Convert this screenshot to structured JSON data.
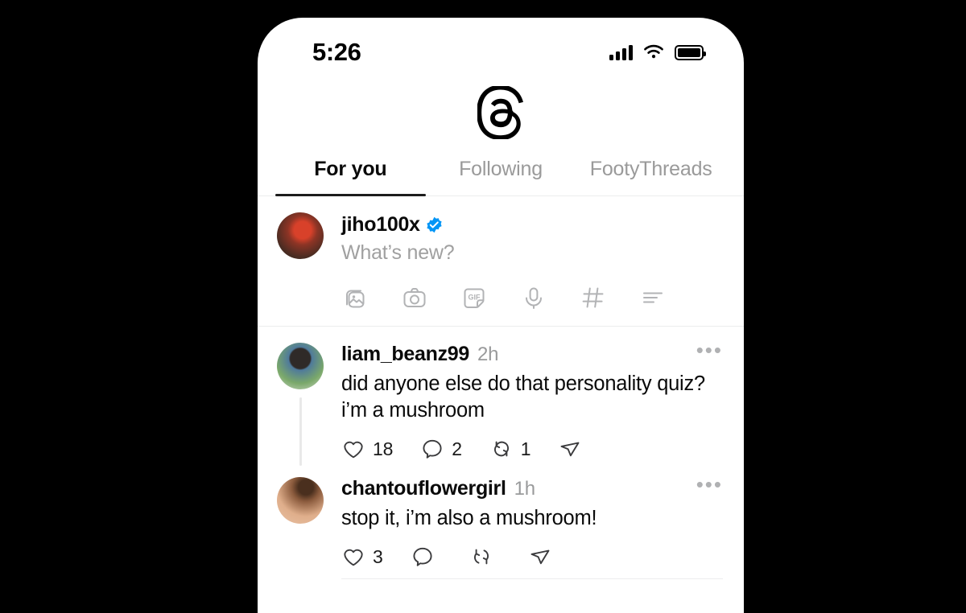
{
  "status_bar": {
    "time": "5:26",
    "cellular_icon": "signal-bars-icon",
    "wifi_icon": "wifi-icon",
    "battery_icon": "battery-full-icon"
  },
  "app": {
    "name": "Threads",
    "logo_icon": "threads-logo-icon"
  },
  "tabs": [
    {
      "label": "For you",
      "active": true
    },
    {
      "label": "Following",
      "active": false
    },
    {
      "label": "FootyThreads",
      "active": false
    }
  ],
  "composer": {
    "username": "jiho100x",
    "verified": true,
    "verified_color": "#0095F6",
    "placeholder": "What’s new?",
    "avatar_colors": [
      "#5a3a30",
      "#c0392b"
    ],
    "icons": [
      {
        "name": "photo-gallery-icon",
        "label": "Add photo"
      },
      {
        "name": "camera-icon",
        "label": "Camera"
      },
      {
        "name": "gif-sticker-icon",
        "label": "GIF"
      },
      {
        "name": "microphone-icon",
        "label": "Voice"
      },
      {
        "name": "hashtag-icon",
        "label": "Tag"
      },
      {
        "name": "poll-list-icon",
        "label": "Poll"
      }
    ]
  },
  "posts": [
    {
      "username": "liam_beanz99",
      "timestamp": "2h",
      "text": "did anyone else do that personality quiz? i’m a mushroom",
      "avatar_colors": [
        "#6b8e3d",
        "#2a5f9e"
      ],
      "more_icon": "more-options-icon",
      "actions": {
        "like": {
          "icon": "heart-icon",
          "count": "18"
        },
        "reply": {
          "icon": "comment-icon",
          "count": "2"
        },
        "repost": {
          "icon": "repost-icon",
          "count": "1"
        },
        "share": {
          "icon": "share-icon",
          "count": ""
        }
      }
    },
    {
      "username": "chantouflowergirl",
      "timestamp": "1h",
      "text": "stop it, i’m also a mushroom!",
      "avatar_colors": [
        "#e0b08a",
        "#8a5a3c"
      ],
      "more_icon": "more-options-icon",
      "actions": {
        "like": {
          "icon": "heart-icon",
          "count": "3"
        },
        "reply": {
          "icon": "comment-icon",
          "count": ""
        },
        "repost": {
          "icon": "repost-icon",
          "count": ""
        },
        "share": {
          "icon": "share-icon",
          "count": ""
        }
      }
    }
  ],
  "theme": {
    "background": "#000000",
    "surface": "#ffffff",
    "text_primary": "#0a0a0a",
    "text_secondary": "#999a9b",
    "divider": "#eceded",
    "icon_muted": "#b2b3b5"
  }
}
